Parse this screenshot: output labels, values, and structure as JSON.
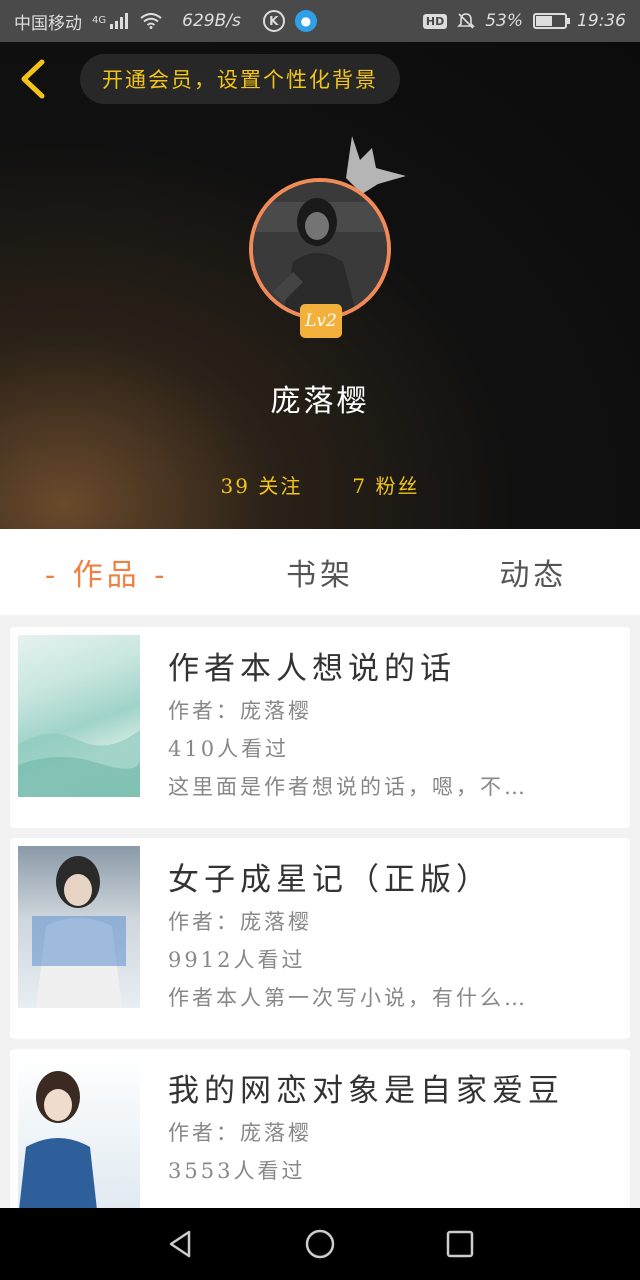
{
  "status_bar": {
    "carrier": "中国移动",
    "network": "4G",
    "speed": "629B/s",
    "battery": "53%",
    "time": "19:36",
    "hd": "HD",
    "k_icon": "K"
  },
  "header": {
    "vip_prompt": "开通会员，设置个性化背景",
    "level": "Lv2",
    "username": "庞落樱",
    "following": "39 关注",
    "followers": "7 粉丝"
  },
  "tabs": [
    {
      "label": "- 作品 -",
      "active": true
    },
    {
      "label": "书架",
      "active": false
    },
    {
      "label": "动态",
      "active": false
    }
  ],
  "books": [
    {
      "title": "作者本人想说的话",
      "author": "作者：庞落樱",
      "views": "410人看过",
      "desc": "这里面是作者想说的话，嗯，不…"
    },
    {
      "title": "女子成星记（正版）",
      "author": "作者：庞落樱",
      "views": "9912人看过",
      "desc": "作者本人第一次写小说，有什么…"
    },
    {
      "title": "我的网恋对象是自家爱豆",
      "author": "作者：庞落樱",
      "views": "3553人看过",
      "desc": ""
    }
  ],
  "colors": {
    "accent": "#f08040",
    "gold": "#f2c419",
    "level_badge": "#f3b13b"
  }
}
